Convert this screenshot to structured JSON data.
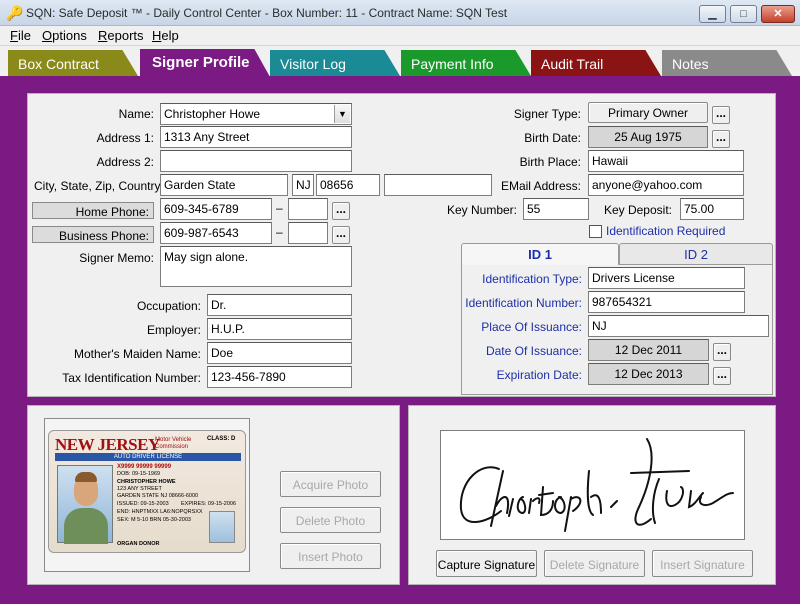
{
  "window": {
    "title": "SQN: Safe Deposit ™ - Daily Control Center - Box Number: 11 - Contract Name: SQN Test",
    "minimize": "▁",
    "maximize": "□",
    "close": "✕"
  },
  "menu": [
    {
      "label": "File",
      "u": "F",
      "rest": "ile"
    },
    {
      "label": "Options",
      "u": "O",
      "rest": "ptions"
    },
    {
      "label": "Reports",
      "u": "R",
      "rest": "eports"
    },
    {
      "label": "Help",
      "u": "H",
      "rest": "elp"
    }
  ],
  "tabs": [
    {
      "label": "Box Contract",
      "color": "#8a8a1a"
    },
    {
      "label": "Signer Profile",
      "color": "#7a1a82"
    },
    {
      "label": "Visitor Log",
      "color": "#1a8a94"
    },
    {
      "label": "Payment Info",
      "color": "#1a9a2a"
    },
    {
      "label": "Audit Trail",
      "color": "#8a1414"
    },
    {
      "label": "Notes",
      "color": "#8a8a8a"
    }
  ],
  "signer": {
    "name_label": "Name:",
    "name_value": "Christopher Howe",
    "address1_label": "Address 1:",
    "address1_value": "1313 Any Street",
    "address2_label": "Address 2:",
    "address2_value": "",
    "csz_label": "City, State, Zip, Country:",
    "city_value": "Garden State",
    "state_value": "NJ",
    "zip_value": "08656",
    "country_value": "",
    "home_phone_label": "Home Phone:",
    "home_phone_value": "609-345-6789",
    "business_phone_label": "Business Phone:",
    "business_phone_value": "609-987-6543",
    "dash": "–",
    "memo_label": "Signer Memo:",
    "memo_value": "May sign alone.",
    "occupation_label": "Occupation:",
    "occupation_value": "Dr.",
    "employer_label": "Employer:",
    "employer_value": "H.U.P.",
    "maiden_label": "Mother's Maiden Name:",
    "maiden_value": "Doe",
    "tax_label": "Tax Identification Number:",
    "tax_value": "123-456-7890"
  },
  "right": {
    "signer_type_label": "Signer Type:",
    "signer_type_value": "Primary Owner",
    "birth_date_label": "Birth Date:",
    "birth_date_value": "25 Aug 1975",
    "birth_place_label": "Birth Place:",
    "birth_place_value": "Hawaii",
    "email_label": "EMail Address:",
    "email_value": "anyone@yahoo.com",
    "key_number_label": "Key Number:",
    "key_number_value": "55",
    "key_deposit_label": "Key Deposit:",
    "key_deposit_value": "75.00",
    "id_required_label": "Identification Required",
    "dots": "..."
  },
  "id_panel": {
    "tab1": "ID 1",
    "tab2": "ID 2",
    "type_label": "Identification Type:",
    "type_value": "Drivers License",
    "number_label": "Identification Number:",
    "number_value": "987654321",
    "place_label": "Place Of Issuance:",
    "place_value": "NJ",
    "issue_label": "Date Of Issuance:",
    "issue_value": "12 Dec 2011",
    "exp_label": "Expiration Date:",
    "exp_value": "12 Dec 2013"
  },
  "photo": {
    "acquire": "Acquire Photo",
    "delete": "Delete Photo",
    "insert": "Insert Photo",
    "license": {
      "state": "NEW JERSEY",
      "agency": "Motor Vehicle Commission",
      "class": "CLASS: D",
      "subtitle": "AUTO DRIVER LICENSE",
      "number": "X9999 99999 99999",
      "dob": "DOB: 09-15-1969",
      "name": "CHRISTOPHER HOWE",
      "street": "123 ANY STREET",
      "city": "GARDEN STATE NJ 08666-6000",
      "issued": "ISSUED: 09-15-2003",
      "expires": "EXPIRES: 09-15-2006",
      "extra": "END: HNPTMXX   LA6:NOPQRSXX",
      "sex": "SEX: M   5-10   BRN   05-30-2003",
      "donor": "ORGAN DONOR"
    }
  },
  "signature": {
    "text": "Christopher Howe",
    "capture": "Capture Signature",
    "delete": "Delete Signature",
    "insert": "Insert Signature"
  }
}
